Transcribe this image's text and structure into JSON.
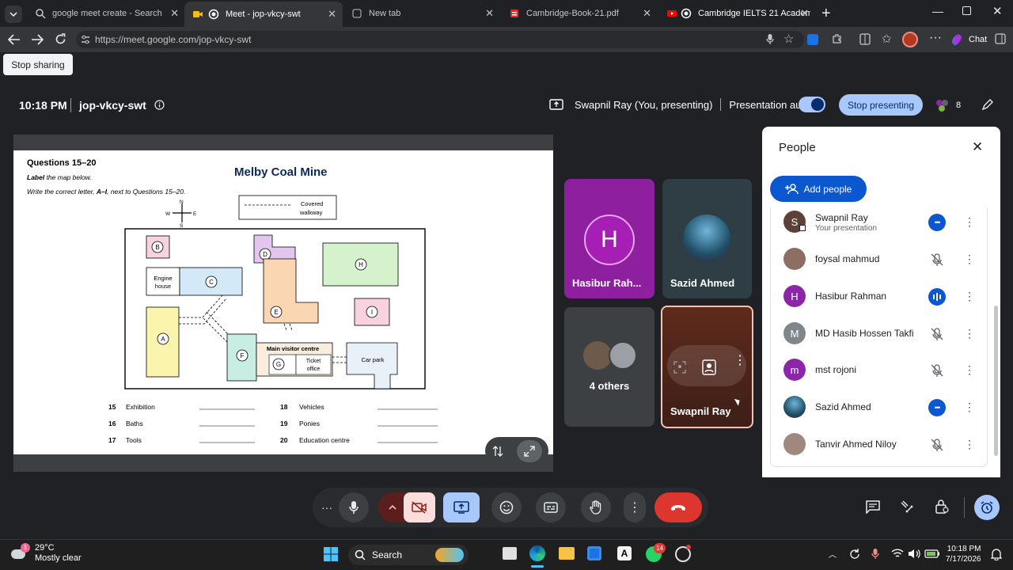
{
  "browser": {
    "tabs": [
      {
        "title": "google meet create - Search",
        "icon": "search-icon"
      },
      {
        "title": "Meet - jop-vkcy-swt",
        "icon": "meet-icon",
        "active": true
      },
      {
        "title": "New tab",
        "icon": "newtab-icon"
      },
      {
        "title": "Cambridge-Book-21.pdf",
        "icon": "pdf-icon"
      },
      {
        "title": "Cambridge IELTS 21 Academic",
        "icon": "youtube-icon"
      }
    ],
    "url": "https://meet.google.com/jop-vkcy-swt",
    "chat_label": "Chat"
  },
  "meet": {
    "stop_sharing": "Stop sharing",
    "time": "10:18 PM",
    "code": "jop-vkcy-swt",
    "presenter_text": "Swapnil Ray (You, presenting)",
    "presentation_audio": "Presentation audio",
    "stop_presenting": "Stop presenting",
    "participant_count": "8"
  },
  "slide": {
    "heading": "Questions 15–20",
    "instruction1_bold": "Label",
    "instruction1_rest": " the map below.",
    "instruction2_a": "Write the correct letter, ",
    "instruction2_b": "A–I",
    "instruction2_c": ", next to Questions 15–20.",
    "title": "Melby Coal Mine",
    "legend_line1": "Covered",
    "legend_line2": "walkway",
    "compass": {
      "n": "N",
      "s": "S",
      "e": "E",
      "w": "W"
    },
    "map": {
      "letters": {
        "A": "A",
        "B": "B",
        "C": "C",
        "D": "D",
        "E": "E",
        "F": "F",
        "G": "G",
        "H": "H",
        "I": "I"
      },
      "engine_house_1": "Engine",
      "engine_house_2": "house",
      "main_visitor_centre": "Main visitor centre",
      "ticket_1": "Ticket",
      "ticket_2": "office",
      "car_park": "Car park"
    },
    "questions": [
      {
        "num": "15",
        "label": "Exhibition"
      },
      {
        "num": "16",
        "label": "Baths"
      },
      {
        "num": "17",
        "label": "Tools"
      },
      {
        "num": "18",
        "label": "Vehicles"
      },
      {
        "num": "19",
        "label": "Ponies"
      },
      {
        "num": "20",
        "label": "Education centre"
      }
    ]
  },
  "tiles": [
    {
      "name": "Hasibur Rah...",
      "initial": "H"
    },
    {
      "name": "Sazid Ahmed"
    },
    {
      "name": "4 others"
    },
    {
      "name": "Swapnil Ray"
    }
  ],
  "people": {
    "title": "People",
    "add_people": "Add people",
    "list": [
      {
        "name": "Swapnil Ray",
        "sub": "Your presentation",
        "initial": "S",
        "avatar_color": "#5d4037",
        "status": "speaking"
      },
      {
        "name": "foysal mahmud",
        "avatar_color": "#8d6e63",
        "status": "muted"
      },
      {
        "name": "Hasibur Rahman",
        "initial": "H",
        "avatar_color": "#8e24aa",
        "status": "talking"
      },
      {
        "name": "MD Hasib Hossen Takfi",
        "initial": "M",
        "avatar_color": "#80868b",
        "status": "muted"
      },
      {
        "name": "mst rojoni",
        "initial": "m",
        "avatar_color": "#8e24aa",
        "status": "muted"
      },
      {
        "name": "Sazid Ahmed",
        "avatar_color": "#37474f",
        "status": "speaking"
      },
      {
        "name": "Tanvir Ahmed Niloy",
        "avatar_color": "#a1887f",
        "status": "muted"
      }
    ]
  },
  "taskbar": {
    "temp": "29°C",
    "weather": "Mostly clear",
    "weather_badge": "1",
    "search": "Search",
    "whatsapp_badge": "14",
    "clock_time": "10:18 PM",
    "clock_date": "7/17/2026"
  }
}
